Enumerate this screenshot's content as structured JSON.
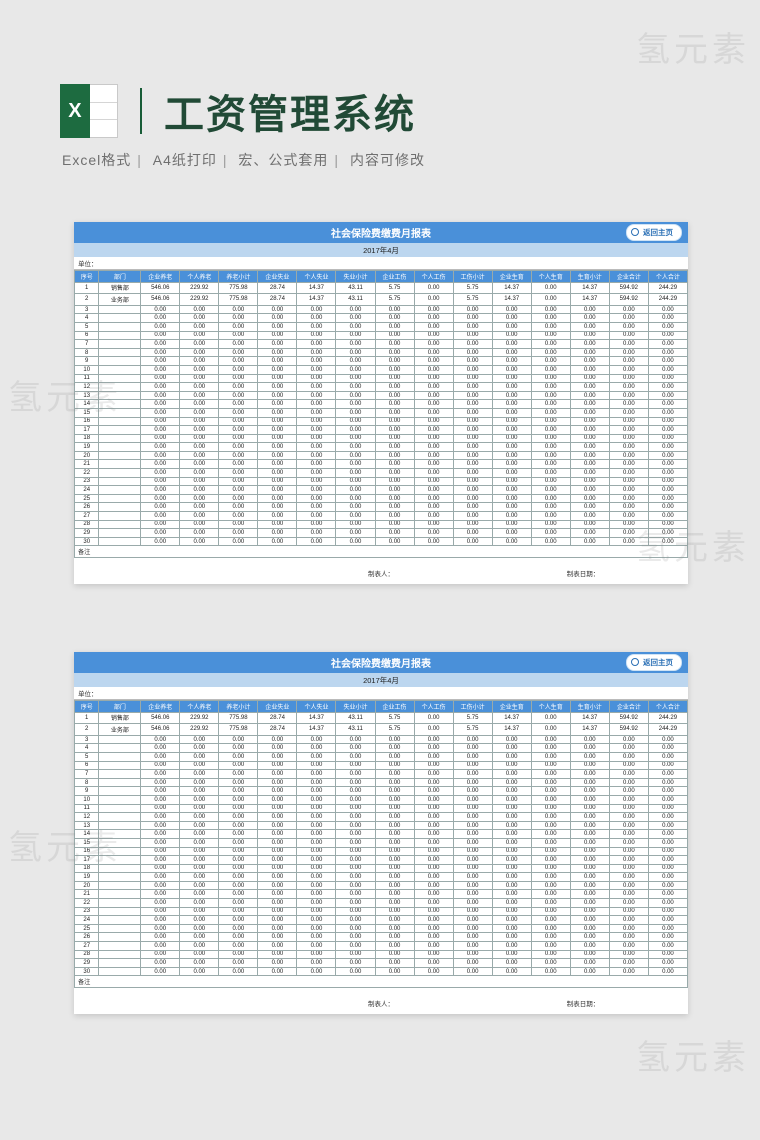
{
  "header": {
    "title": "工资管理系统",
    "excel_x": "X",
    "sub": {
      "a": "Excel格式",
      "b": "A4纸打印",
      "c": "宏、公式套用",
      "d": "内容可修改"
    }
  },
  "watermark": "氢元素",
  "sheet": {
    "title": "社会保险费缴费月报表",
    "date": "2017年4月",
    "unit_label": "单位：",
    "return_home": "返回主页",
    "columns": [
      "序号",
      "部门",
      "企业养老",
      "个人养老",
      "养老小计",
      "企业失业",
      "个人失业",
      "失业小计",
      "企业工伤",
      "个人工伤",
      "工伤小计",
      "企业生育",
      "个人生育",
      "生育小计",
      "企业合计",
      "个人合计"
    ],
    "remark_label": "备注",
    "preparer_label": "制表人：",
    "date_label": "制表日期："
  },
  "chart_data": {
    "type": "table",
    "title": "社会保险费缴费月报表",
    "columns": [
      "序号",
      "部门",
      "企业养老",
      "个人养老",
      "养老小计",
      "企业失业",
      "个人失业",
      "失业小计",
      "企业工伤",
      "个人工伤",
      "工伤小计",
      "企业生育",
      "个人生育",
      "生育小计",
      "企业合计",
      "个人合计"
    ],
    "rows": [
      {
        "seq": 1,
        "dept": "销售部",
        "v": [
          546.06,
          229.92,
          775.98,
          28.74,
          14.37,
          43.11,
          5.75,
          0.0,
          5.75,
          14.37,
          0.0,
          14.37,
          594.92,
          244.29
        ]
      },
      {
        "seq": 2,
        "dept": "业务部",
        "v": [
          546.06,
          229.92,
          775.98,
          28.74,
          14.37,
          43.11,
          5.75,
          0.0,
          5.75,
          14.37,
          0.0,
          14.37,
          594.92,
          244.29
        ]
      },
      {
        "seq": 3,
        "dept": "",
        "v": [
          0.0,
          0.0,
          0.0,
          0.0,
          0.0,
          0.0,
          0.0,
          0.0,
          0.0,
          0.0,
          0.0,
          0.0,
          0.0,
          0.0
        ]
      },
      {
        "seq": 4,
        "dept": "",
        "v": [
          0.0,
          0.0,
          0.0,
          0.0,
          0.0,
          0.0,
          0.0,
          0.0,
          0.0,
          0.0,
          0.0,
          0.0,
          0.0,
          0.0
        ]
      },
      {
        "seq": 5,
        "dept": "",
        "v": [
          0.0,
          0.0,
          0.0,
          0.0,
          0.0,
          0.0,
          0.0,
          0.0,
          0.0,
          0.0,
          0.0,
          0.0,
          0.0,
          0.0
        ]
      },
      {
        "seq": 6,
        "dept": "",
        "v": [
          0.0,
          0.0,
          0.0,
          0.0,
          0.0,
          0.0,
          0.0,
          0.0,
          0.0,
          0.0,
          0.0,
          0.0,
          0.0,
          0.0
        ]
      },
      {
        "seq": 7,
        "dept": "",
        "v": [
          0.0,
          0.0,
          0.0,
          0.0,
          0.0,
          0.0,
          0.0,
          0.0,
          0.0,
          0.0,
          0.0,
          0.0,
          0.0,
          0.0
        ]
      },
      {
        "seq": 8,
        "dept": "",
        "v": [
          0.0,
          0.0,
          0.0,
          0.0,
          0.0,
          0.0,
          0.0,
          0.0,
          0.0,
          0.0,
          0.0,
          0.0,
          0.0,
          0.0
        ]
      },
      {
        "seq": 9,
        "dept": "",
        "v": [
          0.0,
          0.0,
          0.0,
          0.0,
          0.0,
          0.0,
          0.0,
          0.0,
          0.0,
          0.0,
          0.0,
          0.0,
          0.0,
          0.0
        ]
      },
      {
        "seq": 10,
        "dept": "",
        "v": [
          0.0,
          0.0,
          0.0,
          0.0,
          0.0,
          0.0,
          0.0,
          0.0,
          0.0,
          0.0,
          0.0,
          0.0,
          0.0,
          0.0
        ]
      },
      {
        "seq": 11,
        "dept": "",
        "v": [
          0.0,
          0.0,
          0.0,
          0.0,
          0.0,
          0.0,
          0.0,
          0.0,
          0.0,
          0.0,
          0.0,
          0.0,
          0.0,
          0.0
        ]
      },
      {
        "seq": 12,
        "dept": "",
        "v": [
          0.0,
          0.0,
          0.0,
          0.0,
          0.0,
          0.0,
          0.0,
          0.0,
          0.0,
          0.0,
          0.0,
          0.0,
          0.0,
          0.0
        ]
      },
      {
        "seq": 13,
        "dept": "",
        "v": [
          0.0,
          0.0,
          0.0,
          0.0,
          0.0,
          0.0,
          0.0,
          0.0,
          0.0,
          0.0,
          0.0,
          0.0,
          0.0,
          0.0
        ]
      },
      {
        "seq": 14,
        "dept": "",
        "v": [
          0.0,
          0.0,
          0.0,
          0.0,
          0.0,
          0.0,
          0.0,
          0.0,
          0.0,
          0.0,
          0.0,
          0.0,
          0.0,
          0.0
        ]
      },
      {
        "seq": 15,
        "dept": "",
        "v": [
          0.0,
          0.0,
          0.0,
          0.0,
          0.0,
          0.0,
          0.0,
          0.0,
          0.0,
          0.0,
          0.0,
          0.0,
          0.0,
          0.0
        ]
      },
      {
        "seq": 16,
        "dept": "",
        "v": [
          0.0,
          0.0,
          0.0,
          0.0,
          0.0,
          0.0,
          0.0,
          0.0,
          0.0,
          0.0,
          0.0,
          0.0,
          0.0,
          0.0
        ]
      },
      {
        "seq": 17,
        "dept": "",
        "v": [
          0.0,
          0.0,
          0.0,
          0.0,
          0.0,
          0.0,
          0.0,
          0.0,
          0.0,
          0.0,
          0.0,
          0.0,
          0.0,
          0.0
        ]
      },
      {
        "seq": 18,
        "dept": "",
        "v": [
          0.0,
          0.0,
          0.0,
          0.0,
          0.0,
          0.0,
          0.0,
          0.0,
          0.0,
          0.0,
          0.0,
          0.0,
          0.0,
          0.0
        ]
      },
      {
        "seq": 19,
        "dept": "",
        "v": [
          0.0,
          0.0,
          0.0,
          0.0,
          0.0,
          0.0,
          0.0,
          0.0,
          0.0,
          0.0,
          0.0,
          0.0,
          0.0,
          0.0
        ]
      },
      {
        "seq": 20,
        "dept": "",
        "v": [
          0.0,
          0.0,
          0.0,
          0.0,
          0.0,
          0.0,
          0.0,
          0.0,
          0.0,
          0.0,
          0.0,
          0.0,
          0.0,
          0.0
        ]
      },
      {
        "seq": 21,
        "dept": "",
        "v": [
          0.0,
          0.0,
          0.0,
          0.0,
          0.0,
          0.0,
          0.0,
          0.0,
          0.0,
          0.0,
          0.0,
          0.0,
          0.0,
          0.0
        ]
      },
      {
        "seq": 22,
        "dept": "",
        "v": [
          0.0,
          0.0,
          0.0,
          0.0,
          0.0,
          0.0,
          0.0,
          0.0,
          0.0,
          0.0,
          0.0,
          0.0,
          0.0,
          0.0
        ]
      },
      {
        "seq": 23,
        "dept": "",
        "v": [
          0.0,
          0.0,
          0.0,
          0.0,
          0.0,
          0.0,
          0.0,
          0.0,
          0.0,
          0.0,
          0.0,
          0.0,
          0.0,
          0.0
        ]
      },
      {
        "seq": 24,
        "dept": "",
        "v": [
          0.0,
          0.0,
          0.0,
          0.0,
          0.0,
          0.0,
          0.0,
          0.0,
          0.0,
          0.0,
          0.0,
          0.0,
          0.0,
          0.0
        ]
      },
      {
        "seq": 25,
        "dept": "",
        "v": [
          0.0,
          0.0,
          0.0,
          0.0,
          0.0,
          0.0,
          0.0,
          0.0,
          0.0,
          0.0,
          0.0,
          0.0,
          0.0,
          0.0
        ]
      },
      {
        "seq": 26,
        "dept": "",
        "v": [
          0.0,
          0.0,
          0.0,
          0.0,
          0.0,
          0.0,
          0.0,
          0.0,
          0.0,
          0.0,
          0.0,
          0.0,
          0.0,
          0.0
        ]
      },
      {
        "seq": 27,
        "dept": "",
        "v": [
          0.0,
          0.0,
          0.0,
          0.0,
          0.0,
          0.0,
          0.0,
          0.0,
          0.0,
          0.0,
          0.0,
          0.0,
          0.0,
          0.0
        ]
      },
      {
        "seq": 28,
        "dept": "",
        "v": [
          0.0,
          0.0,
          0.0,
          0.0,
          0.0,
          0.0,
          0.0,
          0.0,
          0.0,
          0.0,
          0.0,
          0.0,
          0.0,
          0.0
        ]
      },
      {
        "seq": 29,
        "dept": "",
        "v": [
          0.0,
          0.0,
          0.0,
          0.0,
          0.0,
          0.0,
          0.0,
          0.0,
          0.0,
          0.0,
          0.0,
          0.0,
          0.0,
          0.0
        ]
      },
      {
        "seq": 30,
        "dept": "",
        "v": [
          0.0,
          0.0,
          0.0,
          0.0,
          0.0,
          0.0,
          0.0,
          0.0,
          0.0,
          0.0,
          0.0,
          0.0,
          0.0,
          0.0
        ]
      }
    ]
  }
}
